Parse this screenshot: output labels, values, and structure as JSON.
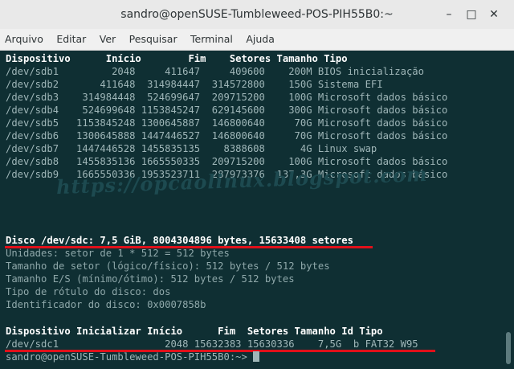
{
  "window": {
    "title": "sandro@openSUSE-Tumbleweed-POS-PIH55B0:~",
    "buttons": {
      "minimize": "–",
      "maximize": "□",
      "close": "✕"
    }
  },
  "menu": [
    "Arquivo",
    "Editar",
    "Ver",
    "Pesquisar",
    "Terminal",
    "Ajuda"
  ],
  "terminal": {
    "table1_header": "Dispositivo      Início        Fim    Setores Tamanho Tipo",
    "table1_rows": [
      "/dev/sdb1         2048     411647     409600    200M BIOS inicialização",
      "/dev/sdb2       411648  314984447  314572800    150G Sistema EFI",
      "/dev/sdb3    314984448  524699647  209715200    100G Microsoft dados básico",
      "/dev/sdb4    524699648 1153845247  629145600    300G Microsoft dados básico",
      "/dev/sdb5   1153845248 1300645887  146800640     70G Microsoft dados básico",
      "/dev/sdb6   1300645888 1447446527  146800640     70G Microsoft dados básico",
      "/dev/sdb7   1447446528 1455835135    8388608      4G Linux swap",
      "/dev/sdb8   1455835136 1665550335  209715200    100G Microsoft dados básico",
      "/dev/sdb9   1665550336 1953523711  287973376  137,3G Microsoft dados básico"
    ],
    "watermark": "https://opcaolinux.blogspot.com",
    "disk_header": "Disco /dev/sdc: 7,5 GiB, 8004304896 bytes, 15633408 setores",
    "disk_info": [
      "Unidades: setor de 1 * 512 = 512 bytes",
      "Tamanho de setor (lógico/físico): 512 bytes / 512 bytes",
      "Tamanho E/S (mínimo/ótimo): 512 bytes / 512 bytes",
      "Tipo de rótulo do disco: dos",
      "Identificador do disco: 0x0007858b"
    ],
    "table2_header": "Dispositivo Inicializar Início      Fim  Setores Tamanho Id Tipo",
    "table2_rows": [
      "/dev/sdc1                  2048 15632383 15630336    7,5G  b FAT32 W95"
    ],
    "prompt": "sandro@openSUSE-Tumbleweed-POS-PIH55B0:~> "
  }
}
